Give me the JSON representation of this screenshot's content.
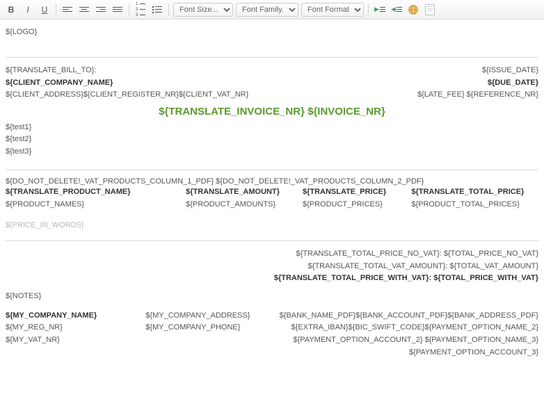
{
  "toolbar": {
    "font_size": "Font Size...",
    "font_family": "Font Family.",
    "font_format": "Font Format"
  },
  "content": {
    "logo": "${LOGO}",
    "bill_to_label": "${TRANSLATE_BILL_TO}:",
    "client_company": "${CLIENT_COMPANY_NAME}",
    "client_line2": "${CLIENT_ADDRESS}${CLIENT_REGISTER_NR}${CLIENT_VAT_NR}",
    "issue_date": "${ISSUE_DATE}",
    "due_date": "${DUE_DATE}",
    "latefee_ref": "${LATE_FEE} ${REFERENCE_NR}",
    "invoice_title": "${TRANSLATE_INVOICE_NR} ${INVOICE_NR}",
    "tests": [
      "${test1}",
      "${test2}",
      "${test3}"
    ],
    "vat_cols": "${DO_NOT_DELETE!_VAT_PRODUCTS_COLUMN_1_PDF} ${DO_NOT_DELETE!_VAT_PRODUCTS_COLUMN_2_PDF}",
    "prod_head_name": "${TRANSLATE_PRODUCT_NAME}",
    "prod_head_amount": "${TRANSLATE_AMOUNT}",
    "prod_head_price": "${TRANSLATE_PRICE}",
    "prod_head_total": "${TRANSLATE_TOTAL_PRICE}",
    "prod_names": "${PRODUCT_NAMES}",
    "prod_amounts": "${PRODUCT_AMOUNTS}",
    "prod_prices": "${PRODUCT_PRICES}",
    "prod_totals": "${PRODUCT_TOTAL_PRICES}",
    "price_in_words": "${PRICE_IN_WORDS}",
    "total_no_vat": "${TRANSLATE_TOTAL_PRICE_NO_VAT}: ${TOTAL_PRICE_NO_VAT}",
    "total_vat_amount": "${TRANSLATE_TOTAL_VAT_AMOUNT}: ${TOTAL_VAT_AMOUNT}",
    "total_with_vat": "${TRANSLATE_TOTAL_PRICE_WITH_VAT}: ${TOTAL_PRICE_WITH_VAT}",
    "notes": "${NOTES}",
    "my_company": "${MY_COMPANY_NAME}",
    "my_reg": "${MY_REG_NR}",
    "my_vat": "${MY_VAT_NR}",
    "my_address": "${MY_COMPANY_ADDRESS}",
    "my_phone": "${MY_COMPANY_PHONE}",
    "bank_line1": "${BANK_NAME_PDF}${BANK_ACCOUNT_PDF}${BANK_ADDRESS_PDF}",
    "bank_line2": "${EXTRA_IBAN}${BIC_SWIFT_CODE}${PAYMENT_OPTION_NAME_2}",
    "bank_line3": "${PAYMENT_OPTION_ACCOUNT_2} ${PAYMENT_OPTION_NAME_3}",
    "bank_line4": "${PAYMENT_OPTION_ACCOUNT_3}"
  }
}
